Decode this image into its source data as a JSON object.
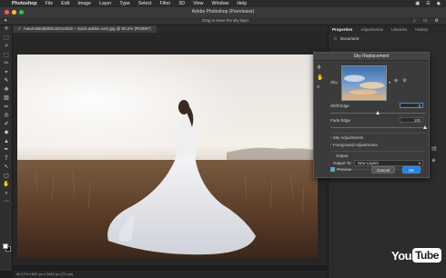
{
  "menubar": {
    "apple": "",
    "items": [
      "Photoshop",
      "File",
      "Edit",
      "Image",
      "Layer",
      "Type",
      "Select",
      "Filter",
      "3D",
      "View",
      "Window",
      "Help"
    ],
    "status_icons": [
      "▣",
      "☰",
      "◉"
    ]
  },
  "window": {
    "title": "Adobe Photoshop (Prerelease)"
  },
  "options_bar": {
    "hint": "Drag to move the sky layer.",
    "right_icons": [
      "⌂",
      "▭",
      "⚙"
    ]
  },
  "toolbar": {
    "tools": [
      "✛",
      "⬚",
      "✧",
      "⬚",
      "✂",
      "⌖",
      "✎",
      "✥",
      "▨",
      "✏",
      "◎",
      "✐",
      "◆",
      "▲",
      "✒",
      "T",
      "↖",
      "▢",
      "✋",
      "⌕",
      "⋯"
    ]
  },
  "document": {
    "tab_label": "AutumnBridalShootGrezbin – stock.adobe.com.jpg @ 50.2% (RGB/8*)",
    "close": "×",
    "status": "50.17%    1690 px x 2810 px (72 ppi)"
  },
  "panel": {
    "tabs": [
      "Properties",
      "Adjustments",
      "Libraries",
      "History"
    ],
    "active_tab": "Properties",
    "row_label": "Document"
  },
  "dialog": {
    "title": "Sky Replacement",
    "tool_icons": [
      "✛",
      "✋",
      "⌕"
    ],
    "sky_label": "Sky:",
    "shift_edge_label": "Shift Edge",
    "shift_edge_value": "0",
    "shift_edge_pct": 50,
    "fade_edge_label": "Fade Edge",
    "fade_edge_value": "100",
    "fade_edge_pct": 100,
    "sky_adjustments": "Sky Adjustments",
    "foreground_adjustments": "Foreground Adjustments",
    "output_section": "Output",
    "output_to_label": "Output To:",
    "output_to_value": "New Layers",
    "preview_label": "Preview",
    "cancel_label": "Cancel",
    "ok_label": "OK"
  },
  "watermark": {
    "you": "You",
    "tube": "Tube"
  },
  "colors": {
    "accent": "#2d7fd8",
    "background": "#1e1e1e"
  }
}
